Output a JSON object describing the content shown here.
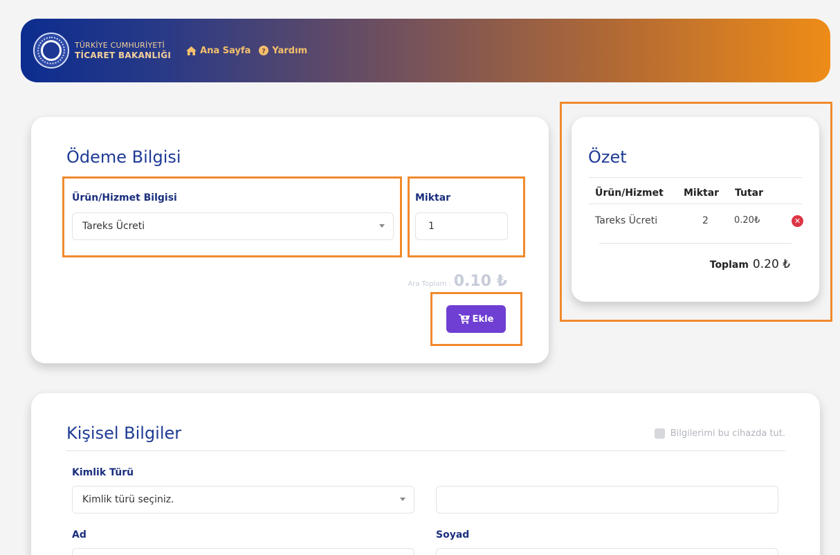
{
  "header": {
    "logo_line1": "TÜRKİYE CUMHURİYETİ",
    "logo_line2": "TİCARET BAKANLIĞI",
    "home_label": "Ana Sayfa",
    "help_label": "Yardım"
  },
  "payment": {
    "title": "Ödeme Bilgisi",
    "product_label": "Ürün/Hizmet Bilgisi",
    "product_selected": "Tareks Ücreti",
    "quantity_label": "Miktar",
    "quantity_value": "1",
    "subtotal_label": "Ara Toplam :",
    "subtotal_value": "0.10 ₺",
    "add_button_label": "Ekle"
  },
  "summary": {
    "title": "Özet",
    "columns": [
      "Ürün/Hizmet",
      "Miktar",
      "Tutar"
    ],
    "rows": [
      {
        "product": "Tareks Ücreti",
        "quantity": "2",
        "amount": "0.20₺"
      }
    ],
    "total_label": "Toplam",
    "total_value": "0.20 ₺"
  },
  "personal": {
    "title": "Kişisel Bilgiler",
    "remember_label": "Bilgilerimi bu cihazda tut.",
    "id_type_label": "Kimlik Türü",
    "id_type_placeholder": "Kimlik türü seçiniz.",
    "first_name_label": "Ad",
    "last_name_label": "Soyad"
  },
  "colors": {
    "accent": "#6e3fd2",
    "title_blue": "#1e3b95",
    "highlight_orange": "#f08a2c",
    "remove_red": "#dc3545"
  }
}
